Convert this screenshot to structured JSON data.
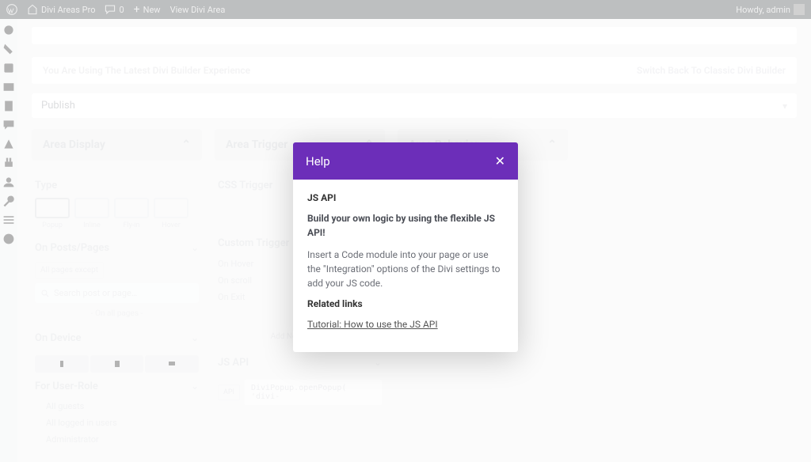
{
  "adminbar": {
    "site": "Divi Areas Pro",
    "comments": "0",
    "new": "New",
    "view": "View Divi Area",
    "howdy": "Howdy, admin"
  },
  "notice_latest": "You Are Using The Latest Divi Builder Experience",
  "switch_back": "Switch Back To Classic Divi Builder",
  "publish": "Publish",
  "panels": {
    "display": "Area Display",
    "trigger": "Area Trigger",
    "behavior": "Area Behavior"
  },
  "display": {
    "type_title": "Type",
    "types": [
      "Popup",
      "Inline",
      "Fly-in",
      "Hover"
    ],
    "posts_title": "On Posts/Pages",
    "posts_mode": "All pages except",
    "search_placeholder": "Search post or page…",
    "on_all": "- On all pages -",
    "device_title": "On Device",
    "role_title": "For User-Role",
    "roles": [
      "All guests",
      "All logged in users",
      "Administrator"
    ]
  },
  "trigger": {
    "css_title": "CSS Trigger",
    "custom_title": "Custom Trigger",
    "rows": [
      [
        "On Hover",
        "-"
      ],
      [
        "On scroll",
        "-"
      ],
      [
        "On Exit",
        "-"
      ]
    ],
    "add": "Add New Trigger",
    "js_api_title": "JS API",
    "api_chip": "API",
    "code": "DiviPopup.openPopup( 'divi-"
  },
  "modal": {
    "title": "Help",
    "h": "JS API",
    "p1": "Build your own logic by using the flexible JS API!",
    "p2": "Insert a Code module into your page or use the \"Integration\" options of the Divi settings to add your JS code.",
    "related": "Related links",
    "link": "Tutorial: How to use the JS API"
  }
}
